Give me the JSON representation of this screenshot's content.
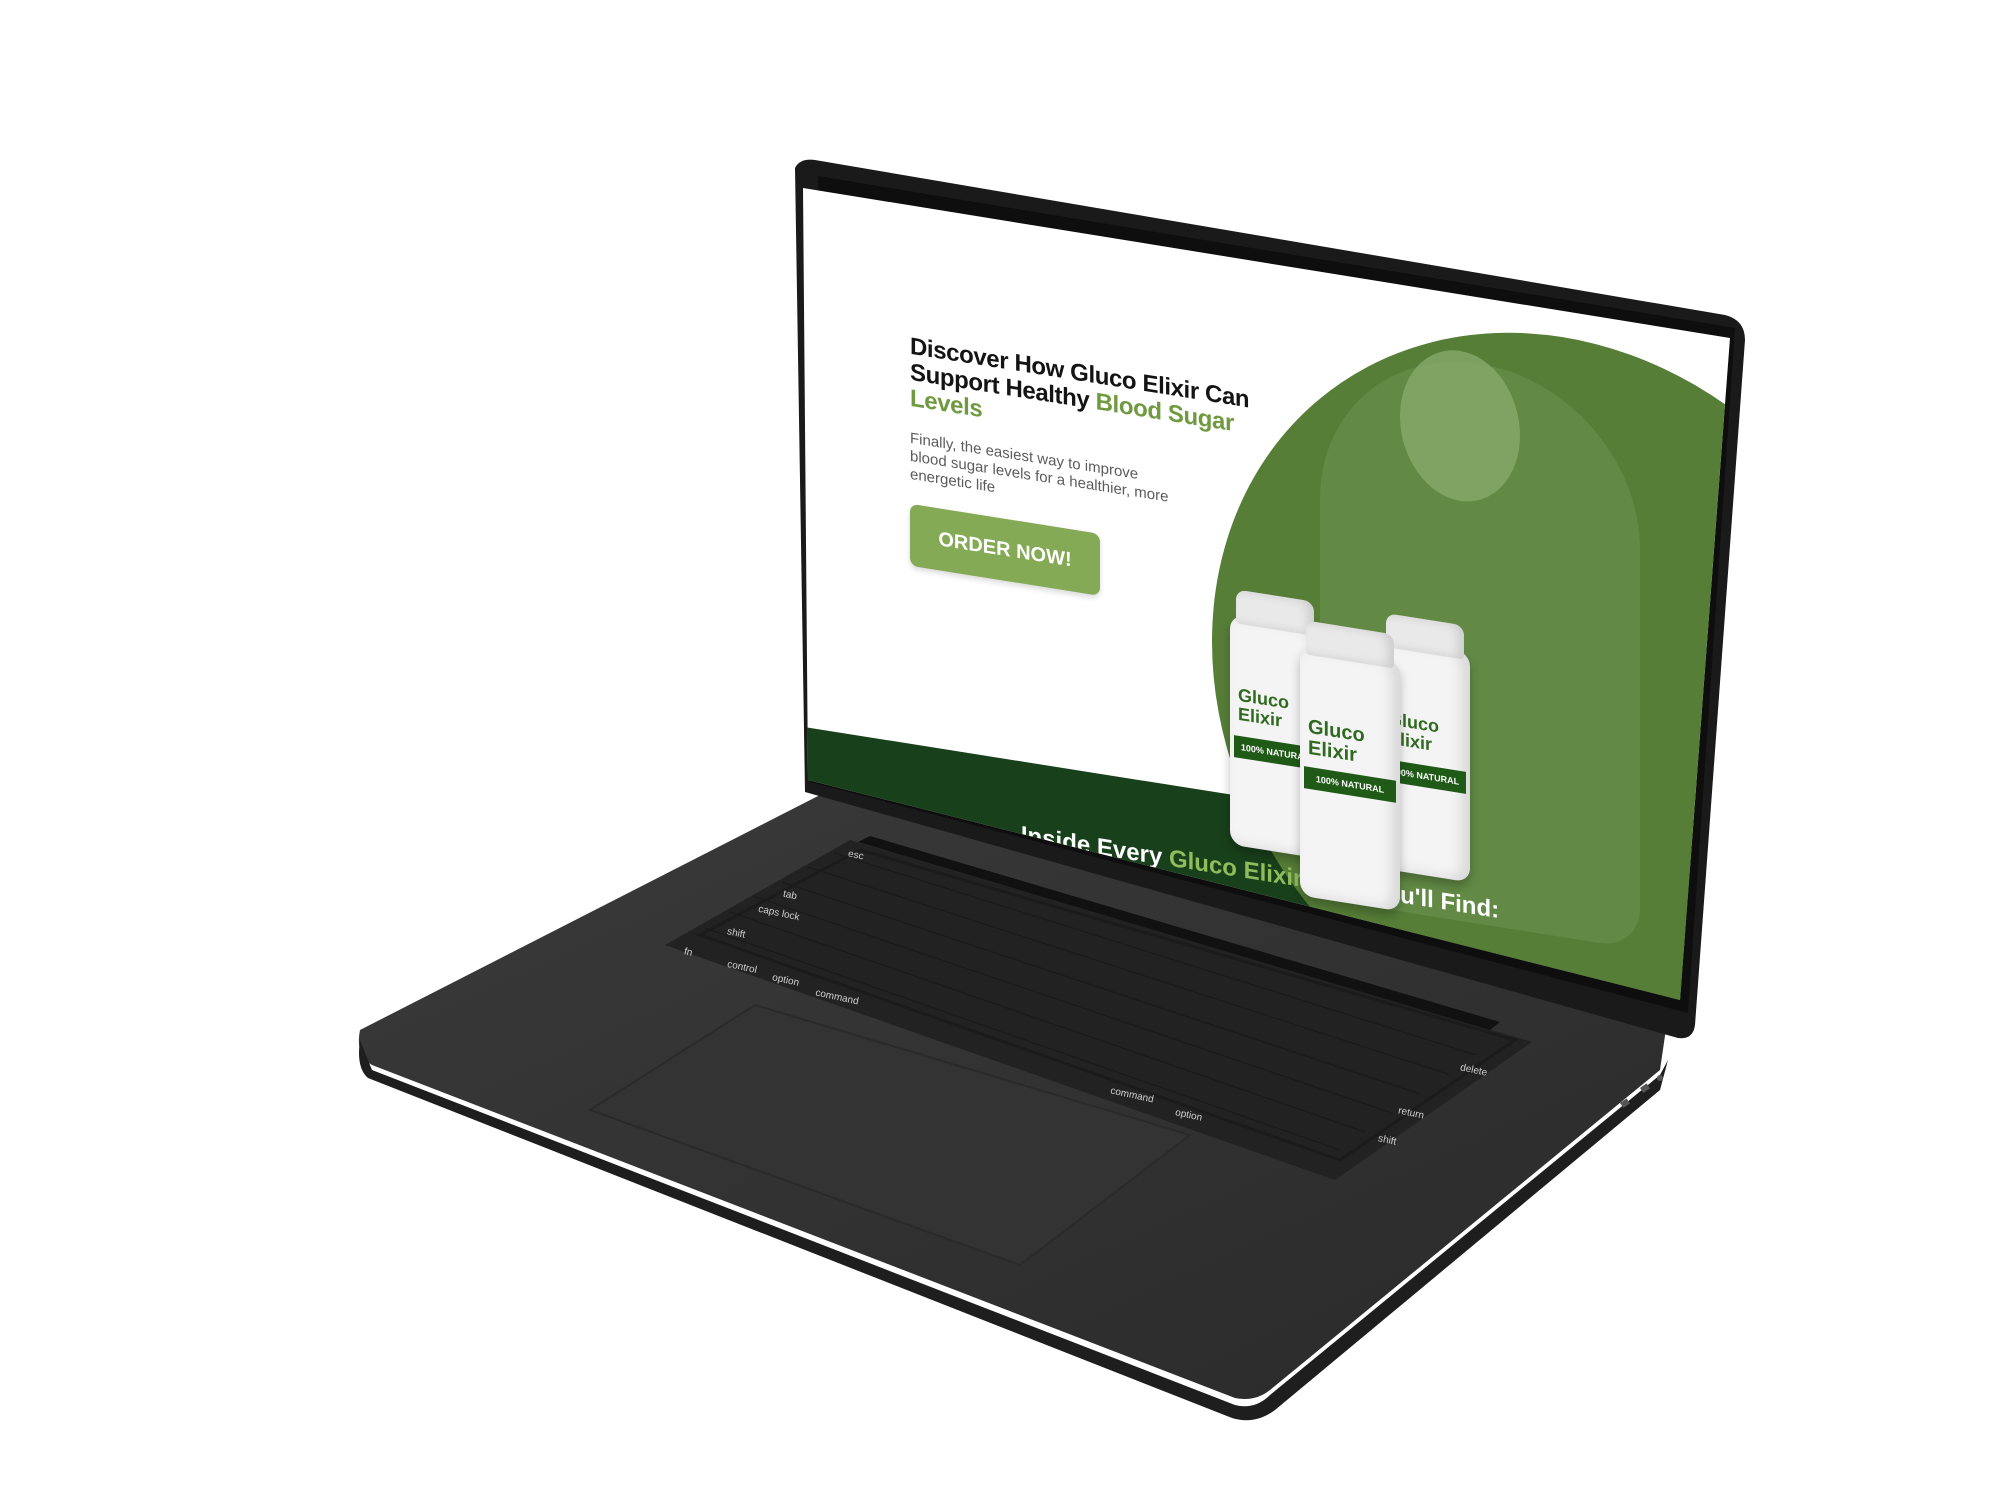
{
  "hero": {
    "headline_part1": "Discover How Gluco Elixir Can Support Healthy ",
    "headline_accent": "Blood Sugar Levels",
    "subtext": "Finally, the easiest way to improve blood sugar levels for a healthier, more energetic life",
    "cta_label": "ORDER NOW!"
  },
  "product": {
    "brand_line1": "Gluco",
    "brand_line2": "Elixir",
    "badge": "100% NATURAL"
  },
  "section": {
    "title_part1": "Inside Every ",
    "title_accent": "Gluco Elixir",
    "title_part2": " Drop You'll Find:"
  },
  "keyboard": {
    "labels": [
      "esc",
      "tab",
      "caps lock",
      "shift",
      "fn",
      "control",
      "option",
      "command",
      "command",
      "option",
      "delete",
      "return",
      "shift"
    ]
  },
  "colors": {
    "accent_green": "#6f9a3f",
    "button_green": "#85aa56",
    "dark_green": "#18401a",
    "laptop_body": "#2f2f2f"
  }
}
